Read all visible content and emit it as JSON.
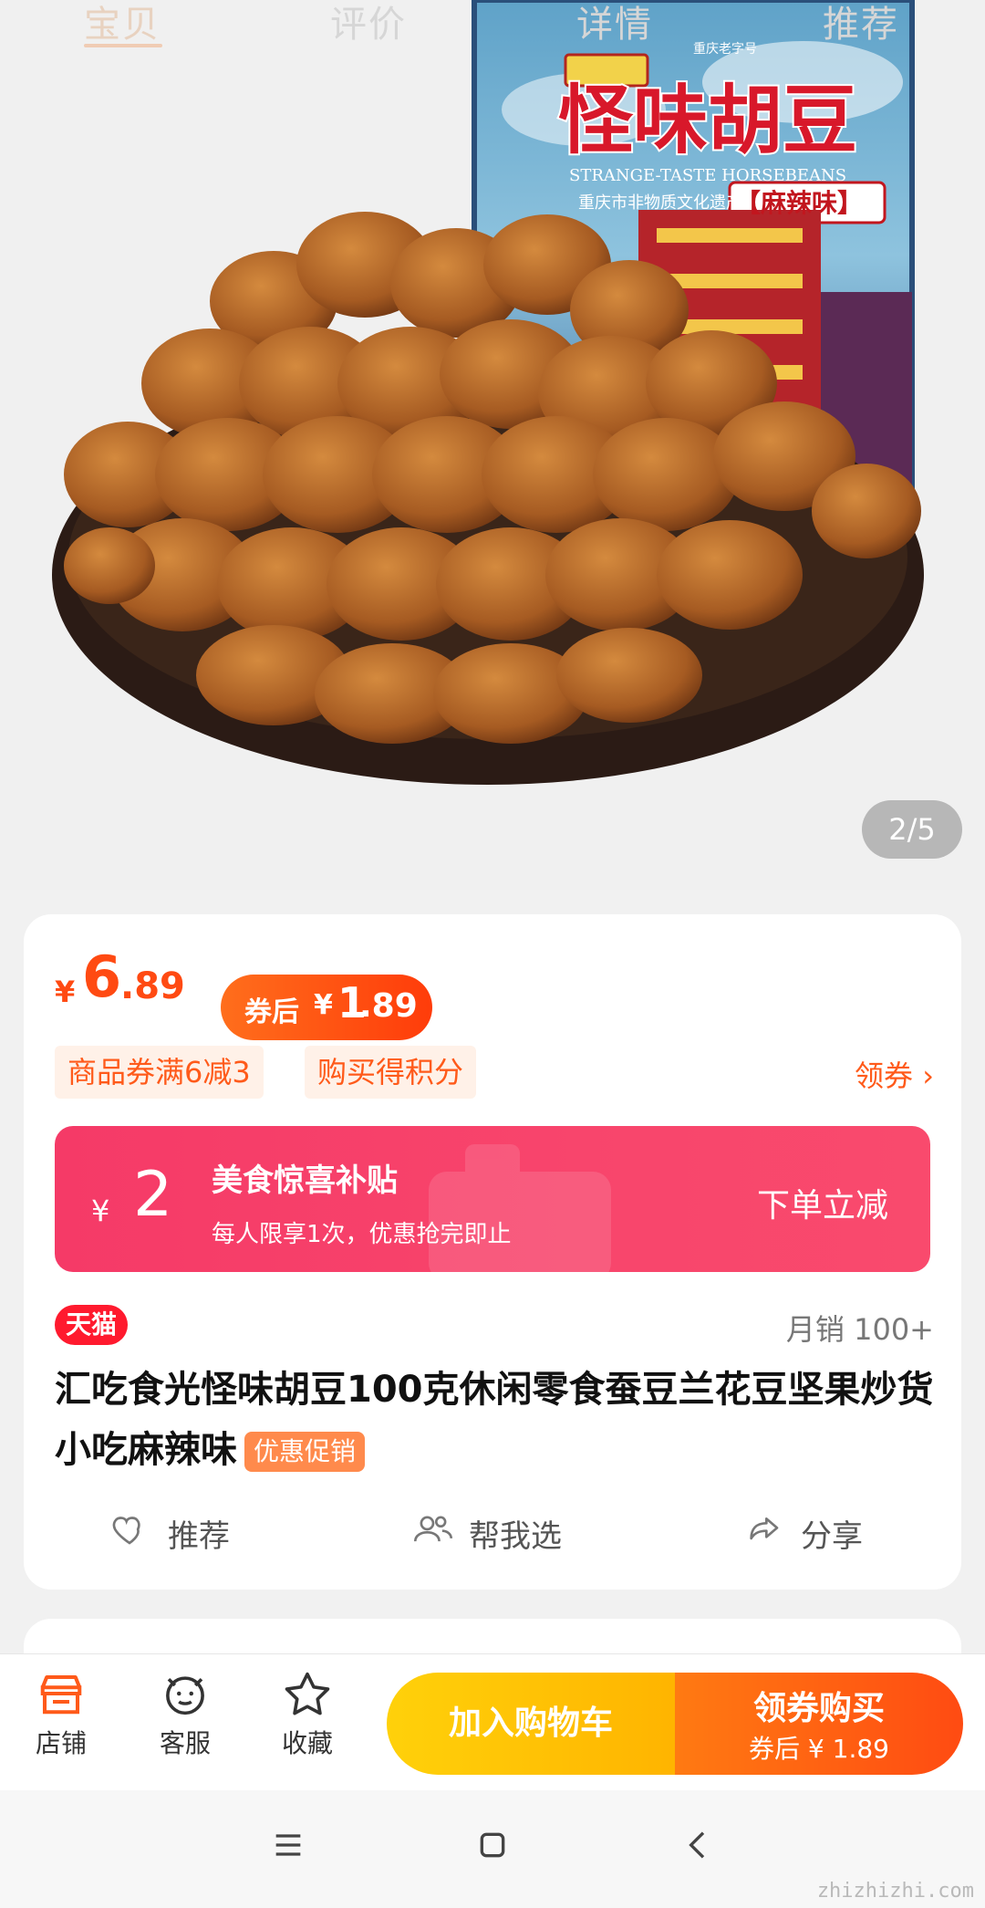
{
  "tabs": [
    "宝贝",
    "评价",
    "详情",
    "推荐"
  ],
  "gallery": {
    "counter": "2/5",
    "package": {
      "brand_badge": "重庆老字号",
      "product_name": "怪味胡豆",
      "english_name": "STRANGE-TASTE HORSEBEANS",
      "heritage_line": "重庆市非物质文化遗产",
      "flavor": "【麻辣味】"
    }
  },
  "price": {
    "currency": "¥",
    "integer": "6",
    "decimal": ".89",
    "after_coupon_label": "券后",
    "after_coupon_integer": "1",
    "after_coupon_decimal": ".89"
  },
  "tags": [
    "商品券满6减3",
    "购买得积分"
  ],
  "coupon_link": "领券 ›",
  "subsidy": {
    "currency": "¥",
    "amount": "2",
    "title": "美食惊喜补贴",
    "desc": "每人限享1次，优惠抢完即止",
    "action": "下单立减"
  },
  "tmall_badge": "天猫",
  "monthly_sales": "月销 100+",
  "product_title": "汇吃食光怪味胡豆100克休闲零食蚕豆兰花豆坚果炒货小吃麻辣味",
  "promo_badge": "优惠促销",
  "actions": [
    "推荐",
    "帮我选",
    "分享"
  ],
  "bottom_bar": {
    "store": "店铺",
    "service": "客服",
    "favorite": "收藏",
    "cart": "加入购物车",
    "buy": "领券购买",
    "buy_sub": "券后 ¥ 1.89"
  },
  "watermark": "zhizhizhi.com",
  "icons": {
    "store": "store-icon",
    "service": "service-icon",
    "favorite": "star-icon",
    "recommend": "heart-icon",
    "help": "users-icon",
    "share": "share-icon"
  },
  "colors": {
    "accent": "#ff4a12",
    "subsidy": "#f8456c",
    "cart": "#ffc20a",
    "buy": "#ff5a12"
  }
}
